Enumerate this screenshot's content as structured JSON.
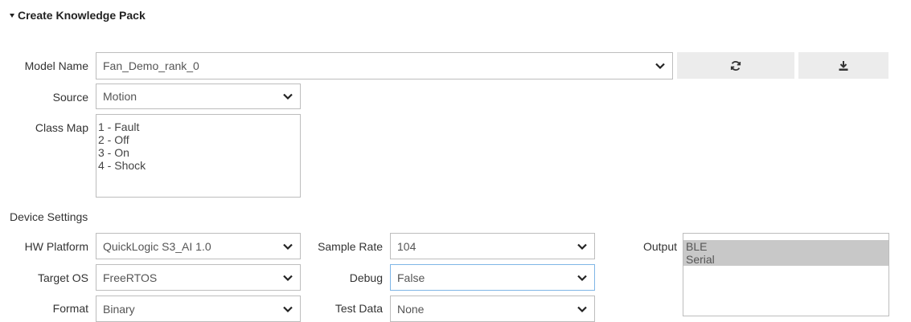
{
  "header": {
    "title": "Create Knowledge Pack"
  },
  "model": {
    "label": "Model Name",
    "value": "Fan_Demo_rank_0"
  },
  "toolbar": {
    "refresh_icon": "refresh-icon",
    "download_icon": "download-icon"
  },
  "source": {
    "label": "Source",
    "value": "Motion"
  },
  "class_map": {
    "label": "Class Map",
    "items": [
      "1 - Fault",
      "2 - Off",
      "3 - On",
      "4 - Shock"
    ]
  },
  "device_settings": {
    "heading": "Device Settings",
    "hw_platform": {
      "label": "HW Platform",
      "value": "QuickLogic S3_AI 1.0"
    },
    "target_os": {
      "label": "Target OS",
      "value": "FreeRTOS"
    },
    "format": {
      "label": "Format",
      "value": "Binary"
    },
    "sample_rate": {
      "label": "Sample Rate",
      "value": "104"
    },
    "debug": {
      "label": "Debug",
      "value": "False"
    },
    "test_data": {
      "label": "Test Data",
      "value": "None"
    },
    "output": {
      "label": "Output",
      "options": [
        "BLE",
        "Serial"
      ]
    }
  }
}
